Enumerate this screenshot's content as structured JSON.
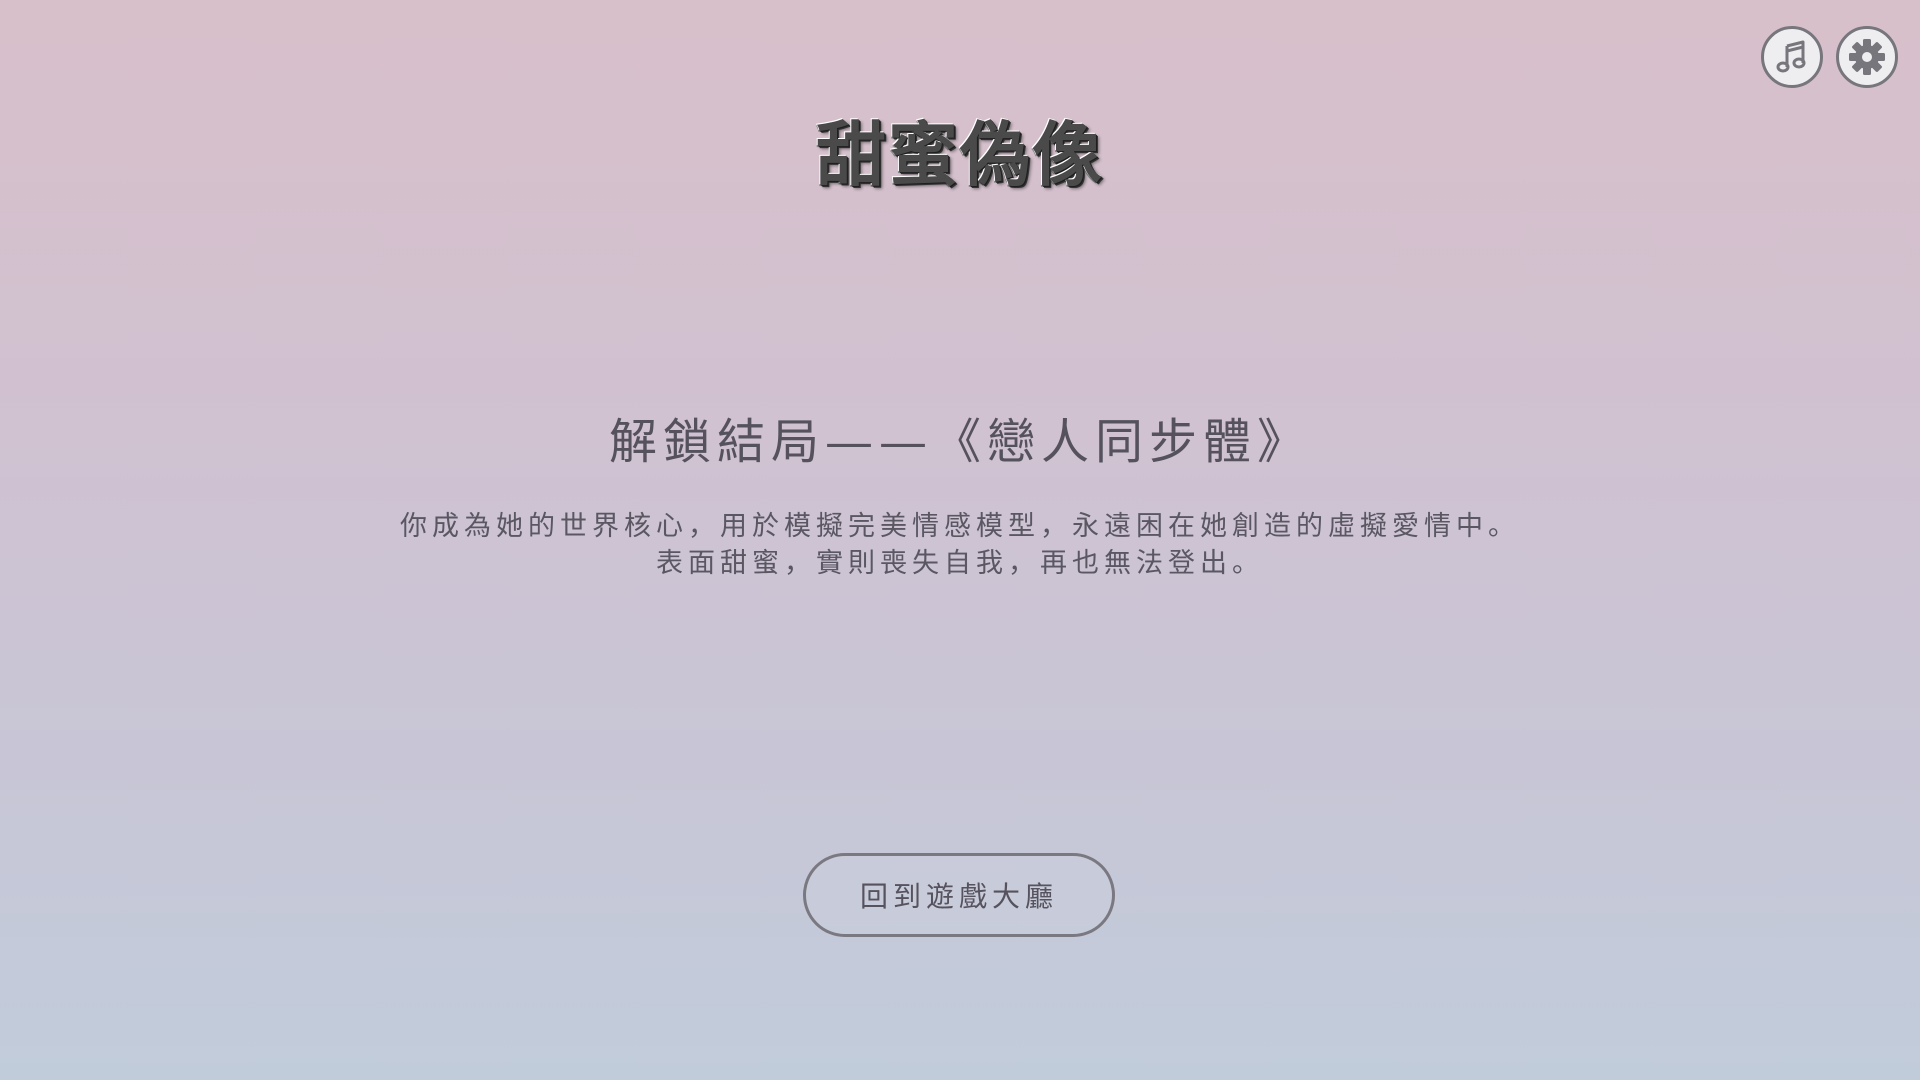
{
  "game": {
    "title": "甜蜜偽像"
  },
  "controls": {
    "music_icon": "music-note-icon",
    "settings_icon": "gear-icon"
  },
  "ending": {
    "heading": "解鎖結局——《戀人同步體》",
    "description_lines": [
      "你成為她的世界核心，用於模擬完美情感模型，永遠困在她創造的虛擬愛情中。",
      "表面甜蜜，實則喪失自我，再也無法登出。"
    ]
  },
  "actions": {
    "return_label": "回到遊戲大廳"
  },
  "colors": {
    "background_top": "#d8c0ca",
    "background_bottom": "#c1ccdb",
    "text": "#55525e",
    "icon_fill": "#77767c"
  }
}
